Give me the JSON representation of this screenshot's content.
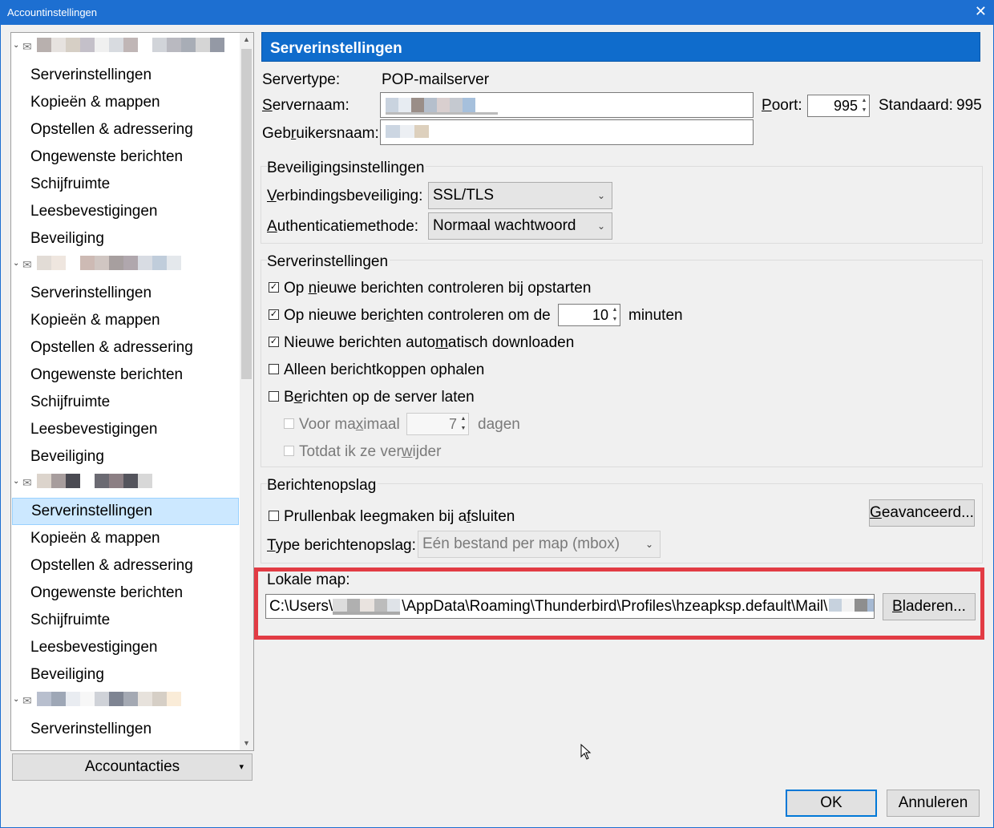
{
  "window": {
    "title": "Accountinstellingen",
    "close_glyph": "✕"
  },
  "tree": {
    "account_groups": [
      {
        "items": [
          "Serverinstellingen",
          "Kopieën & mappen",
          "Opstellen & adressering",
          "Ongewenste berichten",
          "Schijfruimte",
          "Leesbevestigingen",
          "Beveiliging"
        ]
      },
      {
        "items": [
          "Serverinstellingen",
          "Kopieën & mappen",
          "Opstellen & adressering",
          "Ongewenste berichten",
          "Schijfruimte",
          "Leesbevestigingen",
          "Beveiliging"
        ]
      },
      {
        "items": [
          "Serverinstellingen",
          "Kopieën & mappen",
          "Opstellen & adressering",
          "Ongewenste berichten",
          "Schijfruimte",
          "Leesbevestigingen",
          "Beveiliging"
        ],
        "selected_index": 0
      },
      {
        "items": [
          "Serverinstellingen"
        ]
      }
    ],
    "account_actions_label": "Accountacties"
  },
  "panel": {
    "header": "Serverinstellingen",
    "servertype_label": "Servertype:",
    "servertype_value": "POP-mailserver",
    "servername_label": "Servernaam:",
    "port_label": "Poort:",
    "port_value": "995",
    "default_label": "Standaard:",
    "default_value": "995",
    "username_label": "Gebruikersnaam:",
    "security": {
      "legend": "Beveiligingsinstellingen",
      "connection_label": "Verbindingsbeveiliging:",
      "connection_value": "SSL/TLS",
      "auth_label": "Authenticatiemethode:",
      "auth_value": "Normaal wachtwoord"
    },
    "server": {
      "legend": "Serverinstellingen",
      "check_startup": {
        "label": "Op nieuwe berichten controleren bij opstarten",
        "checked": true
      },
      "check_every": {
        "label": "Op nieuwe berichten controleren om de",
        "checked": true,
        "value": "10",
        "unit": "minuten"
      },
      "auto_download": {
        "label": "Nieuwe berichten automatisch downloaden",
        "checked": true
      },
      "headers_only": {
        "label": "Alleen berichtkoppen ophalen",
        "checked": false
      },
      "leave_on_server": {
        "label": "Berichten op de server laten",
        "checked": false
      },
      "max_days": {
        "label": "Voor maximaal",
        "value": "7",
        "unit": "dagen",
        "enabled": false
      },
      "until_delete": {
        "label": "Totdat ik ze verwijder",
        "enabled": false
      }
    },
    "storage": {
      "legend": "Berichtenopslag",
      "empty_trash": {
        "label": "Prullenbak leegmaken bij afsluiten",
        "checked": false
      },
      "advanced_button": "Geavanceerd...",
      "type_label": "Type berichtenopslag:",
      "type_value": "Eén bestand per map (mbox)"
    },
    "local": {
      "label": "Lokale map:",
      "path_prefix": "C:\\Users\\",
      "path_middle": "\\AppData\\Roaming\\Thunderbird\\Profiles\\hzeapksp.default\\Mail\\",
      "browse_button": "Bladeren..."
    }
  },
  "footer": {
    "ok": "OK",
    "cancel": "Annuleren"
  },
  "colors": {
    "accent": "#0f6ccc",
    "highlight": "#e23b44",
    "selection": "#cce8ff"
  }
}
